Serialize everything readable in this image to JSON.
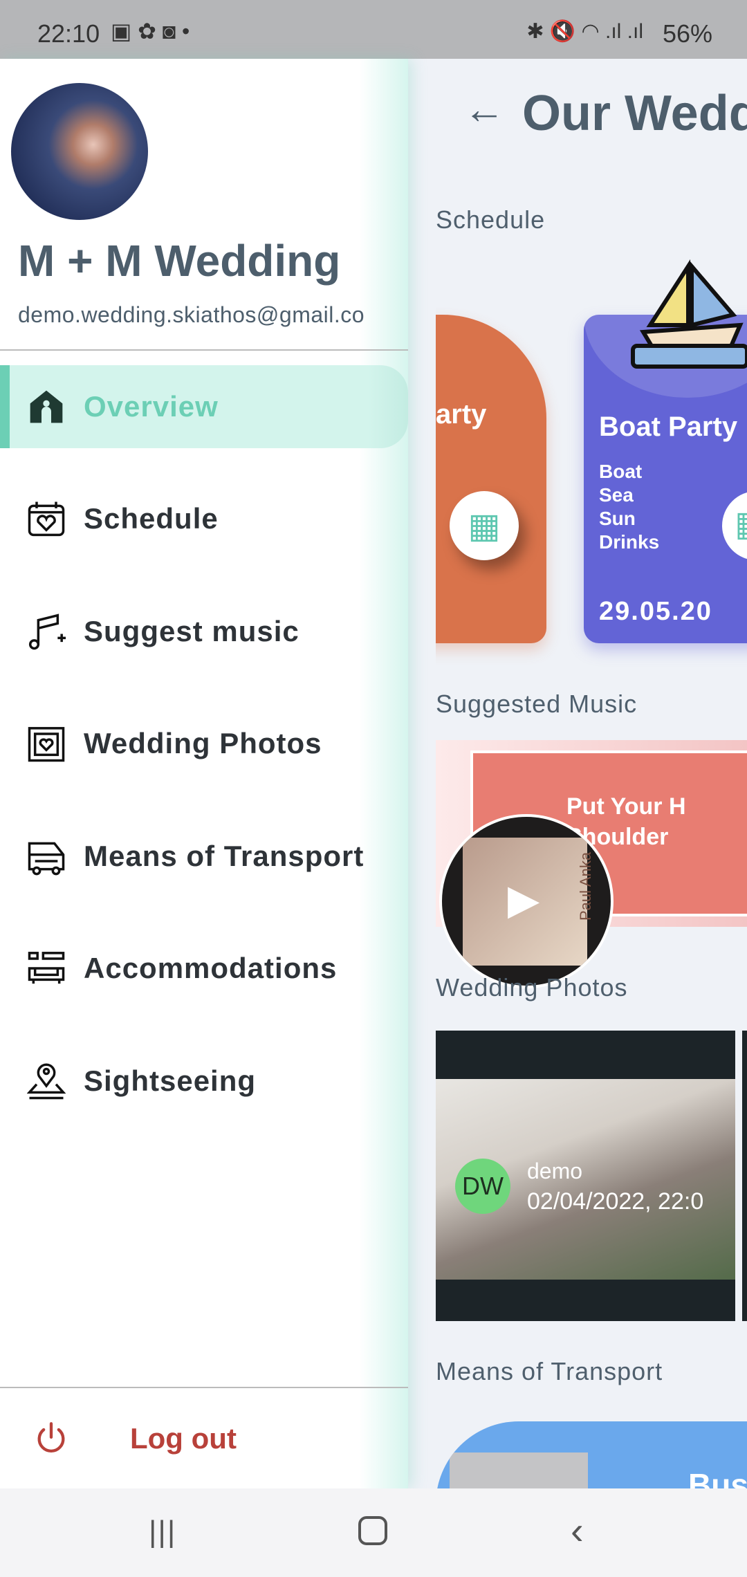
{
  "status": {
    "time": "22:10",
    "battery": "56%"
  },
  "drawer": {
    "title": "M + M Wedding",
    "email": "demo.wedding.skiathos@gmail.co",
    "items": [
      {
        "label": "Overview",
        "icon": "home-icon",
        "active": true
      },
      {
        "label": "Schedule",
        "icon": "calendar-heart-icon"
      },
      {
        "label": "Suggest music",
        "icon": "music-add-icon"
      },
      {
        "label": "Wedding Photos",
        "icon": "photo-frame-icon"
      },
      {
        "label": "Means of Transport",
        "icon": "bus-icon"
      },
      {
        "label": "Accommodations",
        "icon": "sofa-icon"
      },
      {
        "label": "Sightseeing",
        "icon": "location-pin-icon"
      }
    ],
    "logout": "Log out"
  },
  "main": {
    "title": "Our Wedding",
    "sections": {
      "schedule": "Schedule",
      "music": "Suggested Music",
      "photos": "Wedding Photos",
      "transport": "Means of Transport"
    },
    "schedule_cards": [
      {
        "title": "arty",
        "color": "#d9734b"
      },
      {
        "title": "Boat Party",
        "details": [
          "Boat",
          "Sea",
          "Sun",
          "Drinks"
        ],
        "date": "29.05.20",
        "color": "#6364d6"
      }
    ],
    "music": {
      "song": "Put Your H\nShoulder",
      "artist_art_text": "Paul Anka",
      "color": "#e87d72"
    },
    "photo": {
      "initials": "DW",
      "user": "demo",
      "date": "02/04/2022, 22:0"
    },
    "transport": {
      "title": "Bus",
      "color": "#6aa8ec"
    }
  },
  "colors": {
    "accent": "#6ccfb5",
    "logout": "#b8413a",
    "title": "#4d5e6c"
  }
}
